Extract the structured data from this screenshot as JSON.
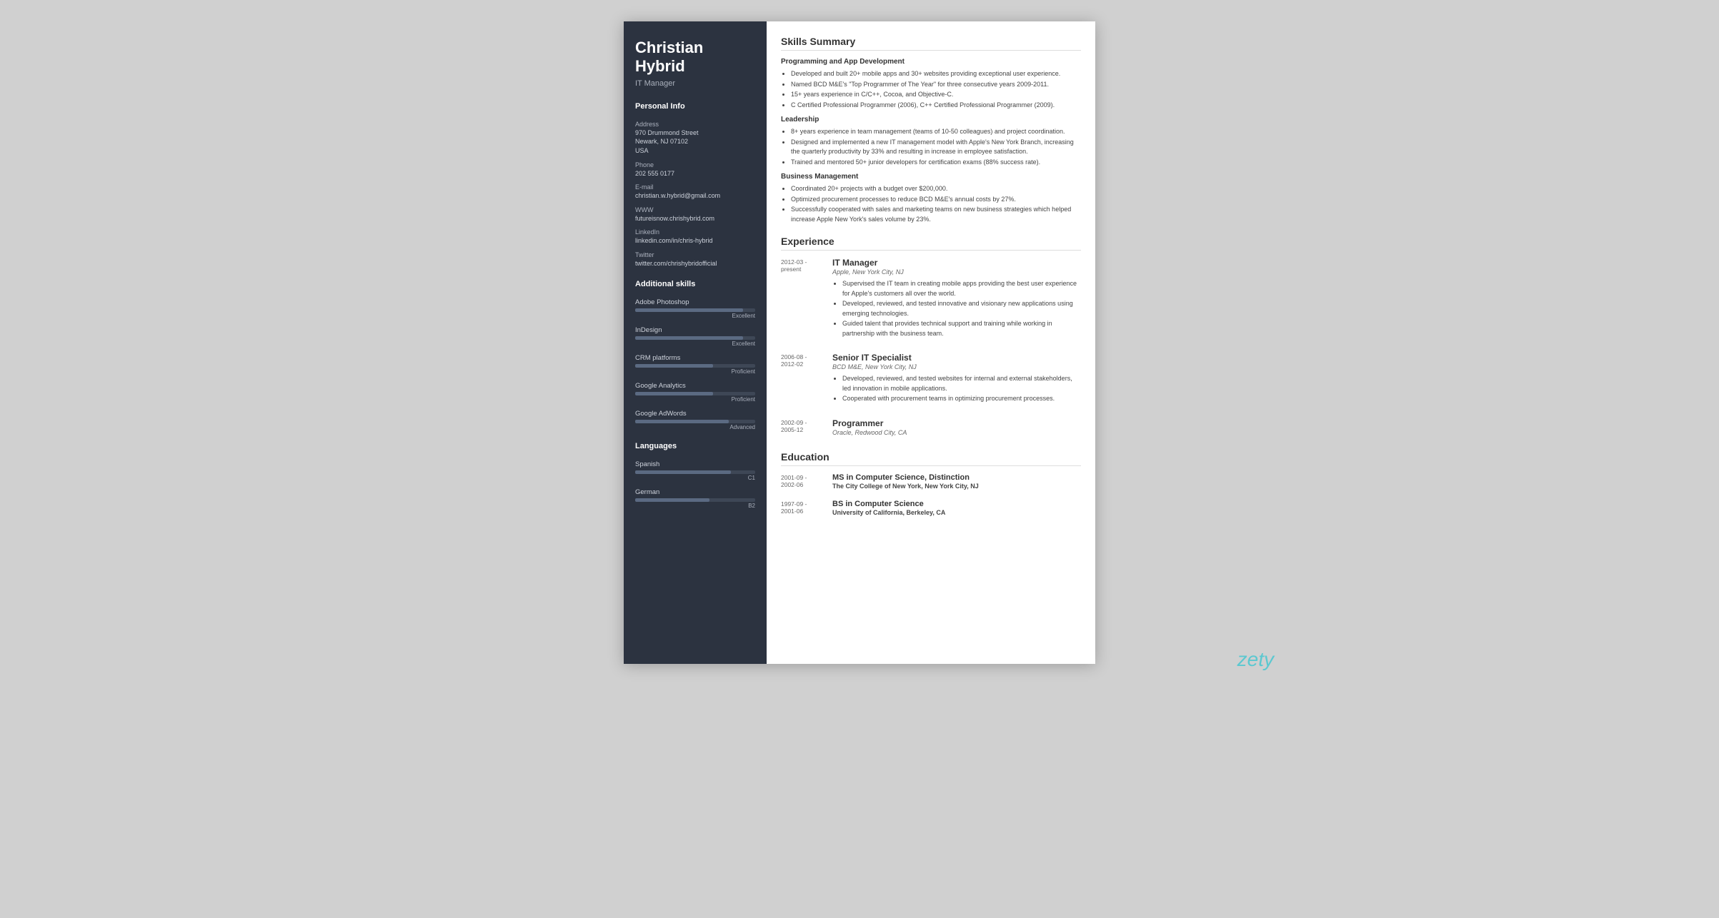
{
  "name": "Christian Hybrid",
  "name_line1": "Christian",
  "name_line2": "Hybrid",
  "job_title": "IT Manager",
  "contact": {
    "address_label": "Address",
    "address_value": "970 Drummond Street\nNewark, NJ 07102\nUSA",
    "phone_label": "Phone",
    "phone_value": "202 555 0177",
    "email_label": "E-mail",
    "email_value": "christian.w.hybrid@gmail.com",
    "www_label": "WWW",
    "www_value": "futureisnow.chrishybrid.com",
    "linkedin_label": "LinkedIn",
    "linkedin_value": "linkedin.com/in/chris-hybrid",
    "twitter_label": "Twitter",
    "twitter_value": "twitter.com/chrishybridofficial"
  },
  "personal_info_label": "Personal Info",
  "additional_skills_label": "Additional skills",
  "skills": [
    {
      "label": "Adobe Photoshop",
      "level": "Excellent",
      "pct": 90
    },
    {
      "label": "InDesign",
      "level": "Excellent",
      "pct": 90
    },
    {
      "label": "CRM platforms",
      "level": "Proficient",
      "pct": 65
    },
    {
      "label": "Google Analytics",
      "level": "Proficient",
      "pct": 65
    },
    {
      "label": "Google AdWords",
      "level": "Advanced",
      "pct": 78
    }
  ],
  "languages_label": "Languages",
  "languages": [
    {
      "label": "Spanish",
      "level": "C1",
      "pct": 80
    },
    {
      "label": "German",
      "level": "B2",
      "pct": 62
    }
  ],
  "skills_summary_title": "Skills Summary",
  "prog_section_title": "Programming and App Development",
  "prog_bullets": [
    "Developed and built 20+ mobile apps and 30+ websites providing exceptional user experience.",
    "Named BCD M&E's \"Top Programmer of The Year\" for three consecutive years 2009-2011.",
    "15+ years experience in C/C++, Cocoa, and Objective-C.",
    "C Certified Professional Programmer (2006), C++ Certified Professional Programmer (2009)."
  ],
  "leadership_section_title": "Leadership",
  "leadership_bullets": [
    "8+ years experience in team management (teams of 10-50 colleagues) and project coordination.",
    "Designed and implemented a new IT management model with Apple's New York Branch, increasing the quarterly productivity by 33% and resulting in increase in employee satisfaction.",
    "Trained and mentored 50+ junior developers for certification exams (88% success rate)."
  ],
  "business_section_title": "Business Management",
  "business_bullets": [
    "Coordinated 20+ projects with a budget over $200,000.",
    "Optimized procurement processes to reduce BCD M&E's annual costs by 27%.",
    "Successfully cooperated with sales and marketing teams on new business strategies which helped increase Apple New York's sales volume by 23%."
  ],
  "experience_title": "Experience",
  "experience": [
    {
      "date": "2012-03 -\npresent",
      "job_title": "IT Manager",
      "company": "Apple, New York City, NJ",
      "bullets": [
        "Supervised the IT team in creating mobile apps providing the best user experience for Apple's customers all over the world.",
        "Developed, reviewed, and tested innovative and visionary new applications using emerging technologies.",
        "Guided talent that provides technical support and training while working in partnership with the business team."
      ]
    },
    {
      "date": "2006-08 -\n2012-02",
      "job_title": "Senior IT Specialist",
      "company": "BCD M&E, New York City, NJ",
      "bullets": [
        "Developed, reviewed, and tested websites for internal and external stakeholders, led innovation in mobile applications.",
        "Cooperated with procurement teams in optimizing procurement processes."
      ]
    },
    {
      "date": "2002-09 -\n2005-12",
      "job_title": "Programmer",
      "company": "Oracle, Redwood City, CA",
      "bullets": []
    }
  ],
  "education_title": "Education",
  "education": [
    {
      "date": "2001-09 -\n2002-06",
      "degree": "MS in Computer Science, Distinction",
      "school": "The City College of New York, New York City, NJ"
    },
    {
      "date": "1997-09 -\n2001-06",
      "degree": "BS in Computer Science",
      "school": "University of California, Berkeley, CA"
    }
  ],
  "zety_label": "zety"
}
